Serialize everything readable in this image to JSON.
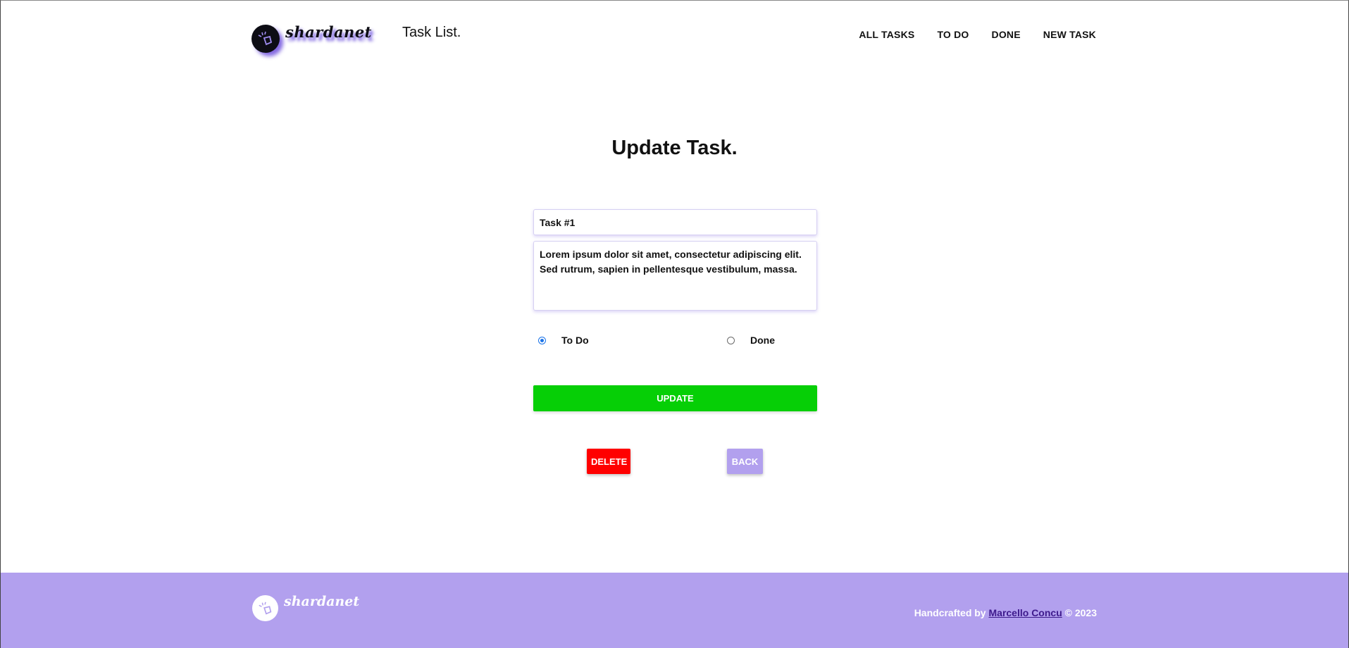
{
  "header": {
    "logo_text": "shardanet",
    "app_title": "Task List.",
    "nav": [
      {
        "label": "ALL TASKS"
      },
      {
        "label": "TO DO"
      },
      {
        "label": "DONE"
      },
      {
        "label": "NEW TASK"
      }
    ]
  },
  "main": {
    "title": "Update Task.",
    "task_title_value": "Task #1",
    "task_description_value": "Lorem ipsum dolor sit amet, consectetur adipiscing elit. Sed rutrum, sapien in pellentesque vestibulum, massa.",
    "status_options": [
      {
        "label": "To Do",
        "checked": true
      },
      {
        "label": "Done",
        "checked": false
      }
    ],
    "update_label": "UPDATE",
    "delete_label": "DELETE",
    "back_label": "BACK"
  },
  "footer": {
    "logo_text": "shardanet",
    "credit_prefix": "Handcrafted by ",
    "author_link": "Marcello Concu",
    "credit_suffix": " © 2023"
  },
  "colors": {
    "accent": "#b2a0ee",
    "update_button": "#06cf06",
    "delete_button": "#ff0000",
    "footer_link": "#3e1a8c"
  },
  "icons": {
    "logo": "shardanet-logo-icon",
    "radio_checked": "radio-checked-icon",
    "radio_unchecked": "radio-unchecked-icon"
  }
}
